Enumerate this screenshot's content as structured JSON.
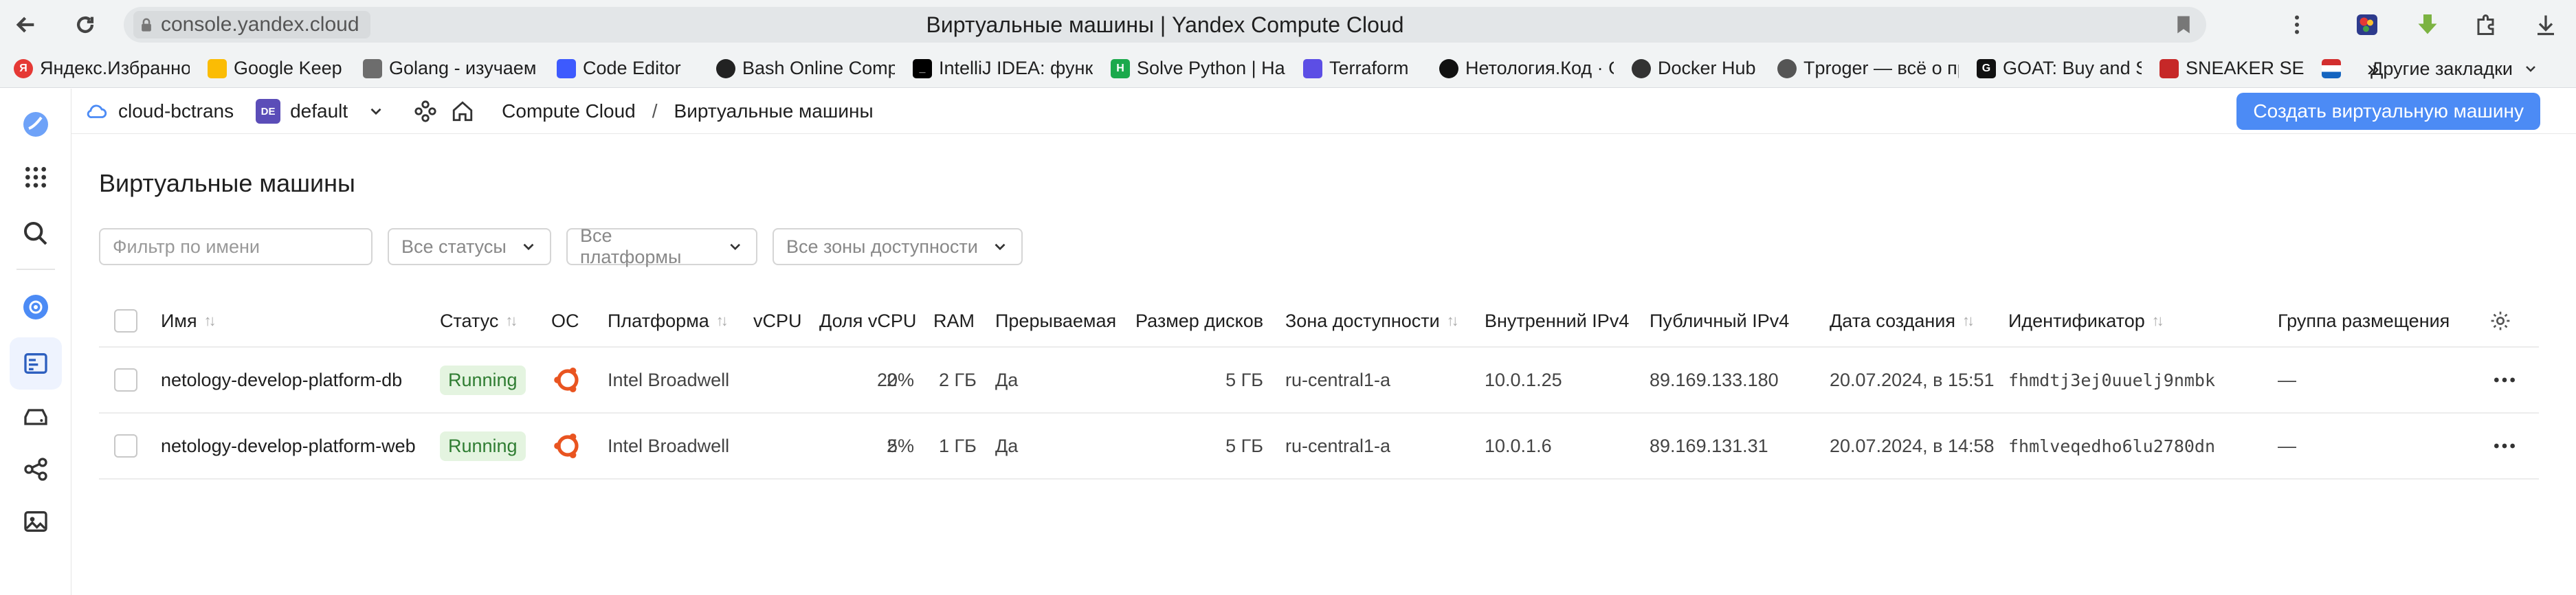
{
  "browser": {
    "url": "console.yandex.cloud",
    "tab_title": "Виртуальные машины | Yandex Compute Cloud",
    "bookmarks": [
      {
        "label": "Яндекс.Избранное",
        "color": "#e53935",
        "icon": "yandex-icon"
      },
      {
        "label": "Google Keep",
        "color": "#fbbc04",
        "icon": "keep-icon"
      },
      {
        "label": "Golang - изучаем",
        "color": "#6d6d6d",
        "icon": "gopher-icon"
      },
      {
        "label": "Code Editor",
        "color": "#3d5afe",
        "icon": "shield-icon"
      },
      {
        "label": "Bash Online Comp",
        "color": "#222222",
        "icon": "bash-icon"
      },
      {
        "label": "IntelliJ IDEA: функ",
        "color": "#000000",
        "icon": "intellij-icon"
      },
      {
        "label": "Solve Python | Hac",
        "color": "#1ba94c",
        "icon": "hackerrank-icon"
      },
      {
        "label": "Terraform",
        "color": "#5c4ee5",
        "icon": "terraform-icon"
      },
      {
        "label": "Нетология.Код · G",
        "color": "#111111",
        "icon": "github-icon"
      },
      {
        "label": "Docker Hub",
        "color": "#333333",
        "icon": "docker-icon"
      },
      {
        "label": "Tproger — всё о пр",
        "color": "#555555",
        "icon": "tproger-icon"
      },
      {
        "label": "GOAT: Buy and Se",
        "color": "#111111",
        "icon": "goat-icon"
      },
      {
        "label": "SNEAKER SE",
        "color": "#c62828",
        "icon": "sneaker-icon"
      }
    ],
    "overflow_label": "»",
    "other_bookmarks": "Другие закладки"
  },
  "header": {
    "cloud": "cloud-bctrans",
    "folder_badge": "DE",
    "folder": "default",
    "breadcrumb_service": "Compute Cloud",
    "breadcrumb_sep": "/",
    "breadcrumb_current": "Виртуальные машины",
    "create_button": "Создать виртуальную машину"
  },
  "page": {
    "title": "Виртуальные машины",
    "filter_placeholder": "Фильтр по имени",
    "status_select": "Все статусы",
    "platform_select": "Все платформы",
    "zone_select": "Все зоны доступности"
  },
  "table": {
    "columns": {
      "name": "Имя",
      "status": "Статус",
      "os": "ОС",
      "platform": "Платформа",
      "vcpu": "vCPU",
      "vcpu_share": "Доля vCPU",
      "ram": "RAM",
      "preemptible": "Прерываемая",
      "disk_size": "Размер дисков",
      "zone": "Зона доступности",
      "internal_ip": "Внутренний IPv4",
      "public_ip": "Публичный IPv4",
      "created": "Дата создания",
      "id": "Идентификатор",
      "placement": "Группа размещения"
    },
    "rows": [
      {
        "name": "netology-develop-platform-db",
        "status": "Running",
        "platform": "Intel Broadwell",
        "vcpu": "2",
        "vcpu_share": "20%",
        "ram": "2 ГБ",
        "preemptible": "Да",
        "disk_size": "5 ГБ",
        "zone": "ru-central1-a",
        "internal_ip": "10.0.1.25",
        "public_ip": "89.169.133.180",
        "created": "20.07.2024, в 15:51",
        "id": "fhmdtj3ej0uuelj9nmbk",
        "placement": "—"
      },
      {
        "name": "netology-develop-platform-web",
        "status": "Running",
        "platform": "Intel Broadwell",
        "vcpu": "2",
        "vcpu_share": "5%",
        "ram": "1 ГБ",
        "preemptible": "Да",
        "disk_size": "5 ГБ",
        "zone": "ru-central1-a",
        "internal_ip": "10.0.1.6",
        "public_ip": "89.169.131.31",
        "created": "20.07.2024, в 14:58",
        "id": "fhmlveqedho6lu2780dn",
        "placement": "—"
      }
    ]
  },
  "colors": {
    "accent": "#4c8bf5",
    "running_bg": "#e4f4e0",
    "running_text": "#2f7d32",
    "ubuntu": "#e95420",
    "folder_badge": "#5b4db8"
  }
}
